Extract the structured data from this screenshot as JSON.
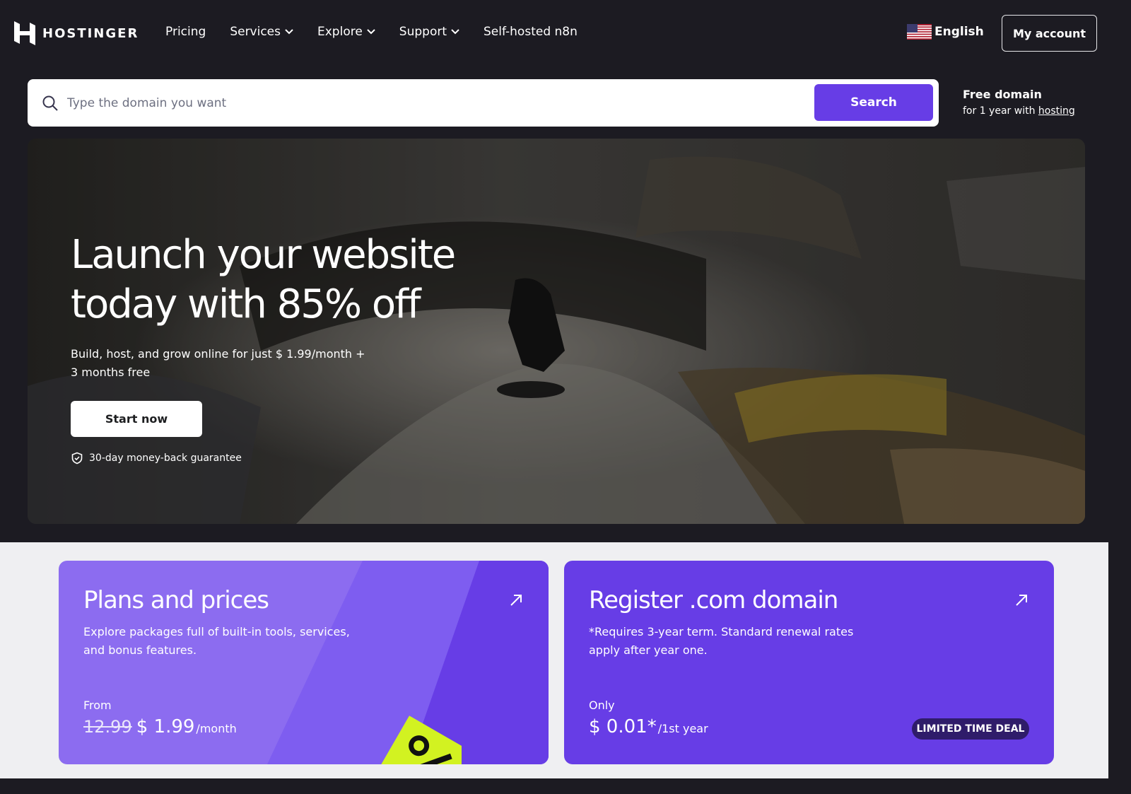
{
  "brand": {
    "name": "HOSTINGER"
  },
  "nav": {
    "items": [
      {
        "label": "Pricing",
        "has_dropdown": false
      },
      {
        "label": "Services",
        "has_dropdown": true
      },
      {
        "label": "Explore",
        "has_dropdown": true
      },
      {
        "label": "Support",
        "has_dropdown": true
      },
      {
        "label": "Self-hosted n8n",
        "has_dropdown": false
      }
    ],
    "language": "English",
    "account_label": "My account"
  },
  "search": {
    "placeholder": "Type the domain you want",
    "value": "",
    "button_label": "Search"
  },
  "free_domain": {
    "title": "Free domain",
    "subtitle_prefix": "for 1 year with ",
    "subtitle_link": "hosting"
  },
  "hero": {
    "title_line1": "Launch your website",
    "title_line2": "today with 85% off",
    "subtitle": "Build, host, and grow online for just $ 1.99/month + 3 months free",
    "cta_label": "Start now",
    "guarantee": "30-day money-back guarantee"
  },
  "cards": {
    "plans": {
      "title": "Plans and prices",
      "text": "Explore packages full of built-in tools, services, and bonus features.",
      "from_label": "From",
      "old_price": "12.99",
      "new_price": "$ 1.99",
      "period": "/month"
    },
    "domain": {
      "title": "Register .com domain",
      "text": "*Requires 3-year term. Standard renewal rates apply after year one.",
      "only_label": "Only",
      "price": "$ 0.01*",
      "period": " /1st year",
      "badge": "LIMITED TIME DEAL"
    }
  },
  "colors": {
    "accent": "#673de6",
    "dark_bg": "#1c1b22",
    "light_bg": "#efeff2",
    "badge_bg": "#2f1c6a",
    "tag_yellow": "#d2f221"
  },
  "icons": [
    "hostinger-logo-icon",
    "chevron-down-icon",
    "us-flag-icon",
    "search-icon",
    "shield-check-icon",
    "arrow-up-right-icon",
    "percent-tag-icon"
  ]
}
